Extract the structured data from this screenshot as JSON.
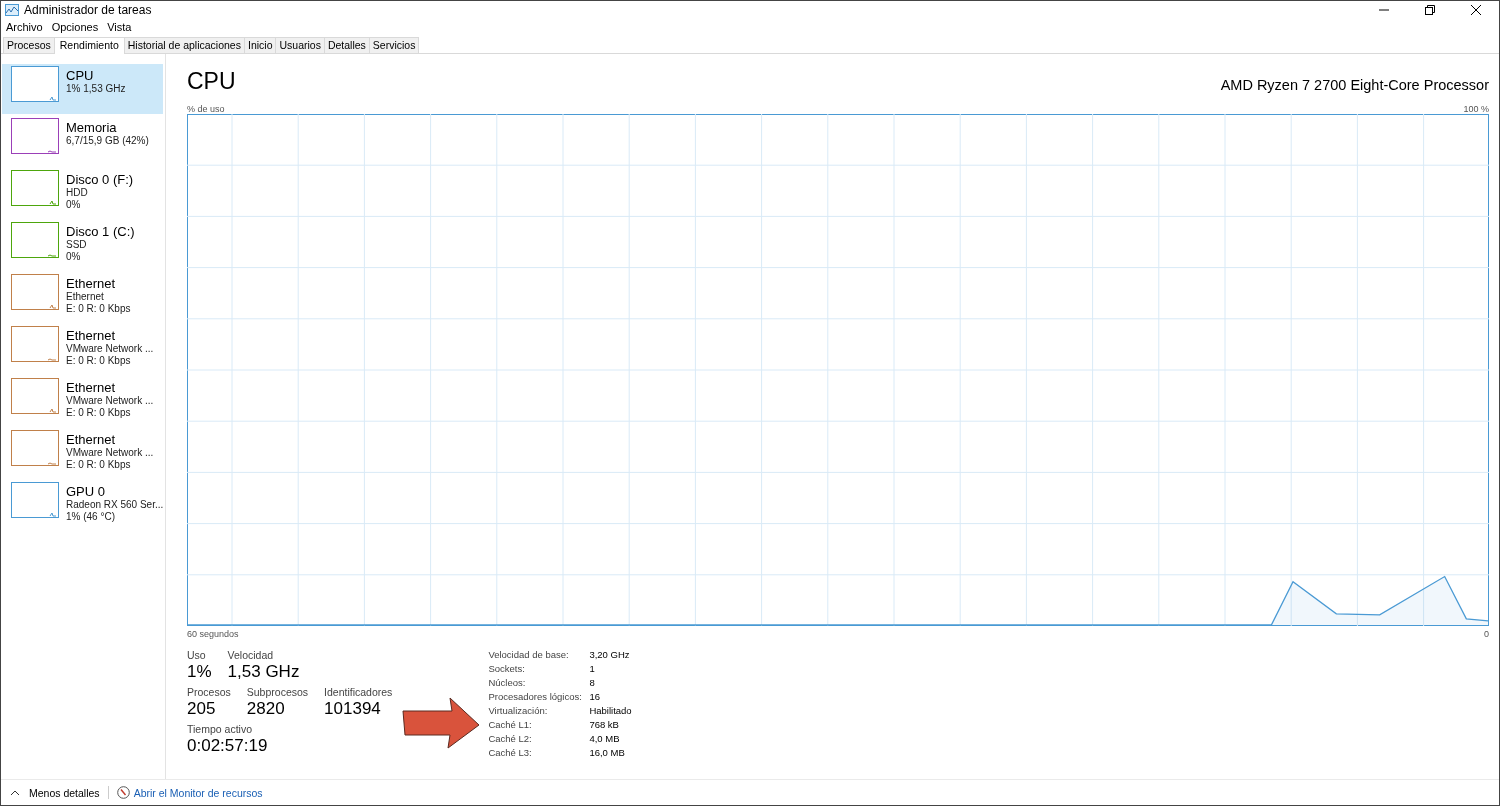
{
  "window": {
    "title": "Administrador de tareas"
  },
  "menu": [
    "Archivo",
    "Opciones",
    "Vista"
  ],
  "tabs": [
    {
      "label": "Procesos",
      "selected": false
    },
    {
      "label": "Rendimiento",
      "selected": true
    },
    {
      "label": "Historial de aplicaciones",
      "selected": false
    },
    {
      "label": "Inicio",
      "selected": false
    },
    {
      "label": "Usuarios",
      "selected": false
    },
    {
      "label": "Detalles",
      "selected": false
    },
    {
      "label": "Servicios",
      "selected": false
    }
  ],
  "sidebar": {
    "items": [
      {
        "name": "CPU",
        "lines": [
          "1% 1,53 GHz"
        ],
        "color": "#4a9ad4",
        "selected": true
      },
      {
        "name": "Memoria",
        "lines": [
          "6,7/15,9 GB (42%)"
        ],
        "color": "#9b3fb8",
        "selected": false
      },
      {
        "name": "Disco 0 (F:)",
        "lines": [
          "HDD",
          "0%"
        ],
        "color": "#4da60c",
        "selected": false
      },
      {
        "name": "Disco 1 (C:)",
        "lines": [
          "SSD",
          "0%"
        ],
        "color": "#4da60c",
        "selected": false
      },
      {
        "name": "Ethernet",
        "lines": [
          "Ethernet",
          "E: 0 R: 0 Kbps"
        ],
        "color": "#c0804a",
        "selected": false
      },
      {
        "name": "Ethernet",
        "lines": [
          "VMware Network ...",
          "E: 0 R: 0 Kbps"
        ],
        "color": "#c0804a",
        "selected": false
      },
      {
        "name": "Ethernet",
        "lines": [
          "VMware Network ...",
          "E: 0 R: 0 Kbps"
        ],
        "color": "#c0804a",
        "selected": false
      },
      {
        "name": "Ethernet",
        "lines": [
          "VMware Network ...",
          "E: 0 R: 0 Kbps"
        ],
        "color": "#c0804a",
        "selected": false
      },
      {
        "name": "GPU 0",
        "lines": [
          "Radeon RX 560 Ser...",
          "1% (46 °C)"
        ],
        "color": "#4a9ad4",
        "selected": false
      }
    ]
  },
  "main": {
    "title": "CPU",
    "processor": "AMD Ryzen 7 2700 Eight-Core Processor",
    "graph": {
      "top_left_label": "% de uso",
      "top_right_label": "100 %",
      "bottom_left_label": "60 segundos",
      "bottom_right_label": "0"
    },
    "stats": [
      [
        {
          "label": "Uso",
          "value": "1%"
        },
        {
          "label": "Velocidad",
          "value": "1,53 GHz"
        }
      ],
      [
        {
          "label": "Procesos",
          "value": "205"
        },
        {
          "label": "Subprocesos",
          "value": "2820"
        },
        {
          "label": "Identificadores",
          "value": "101394"
        }
      ],
      [
        {
          "label": "Tiempo activo",
          "value": "0:02:57:19"
        }
      ]
    ],
    "details": [
      {
        "label": "Velocidad de base:",
        "value": "3,20 GHz"
      },
      {
        "label": "Sockets:",
        "value": "1"
      },
      {
        "label": "Núcleos:",
        "value": "8"
      },
      {
        "label": "Procesadores lógicos:",
        "value": "16"
      },
      {
        "label": "Virtualización:",
        "value": "Habilitado"
      },
      {
        "label": "Caché L1:",
        "value": "768 kB"
      },
      {
        "label": "Caché L2:",
        "value": "4,0 MB"
      },
      {
        "label": "Caché L3:",
        "value": "16,0 MB"
      }
    ]
  },
  "footer": {
    "fewer_details": "Menos detalles",
    "link": "Abrir el Monitor de recursos"
  }
}
